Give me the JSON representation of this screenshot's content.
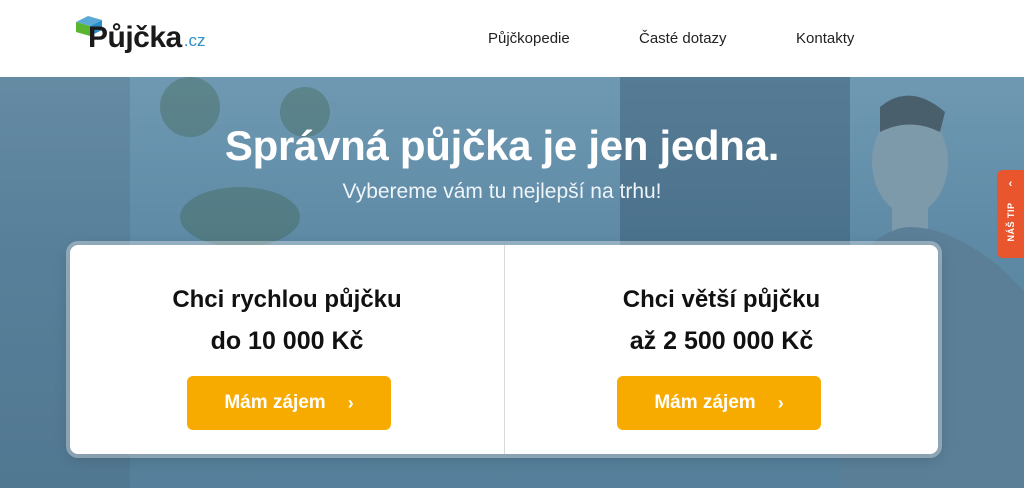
{
  "header": {
    "logo_text": "Půjčka",
    "logo_tld": ".cz",
    "nav": [
      {
        "label": "Půjčkopedie"
      },
      {
        "label": "Časté dotazy"
      },
      {
        "label": "Kontakty"
      }
    ]
  },
  "hero": {
    "title": "Správná půjčka je jen jedna.",
    "subtitle": "Vybereme vám tu nejlepší na trhu!"
  },
  "offers": [
    {
      "line1": "Chci rychlou půjčku",
      "line2": "do 10 000 Kč",
      "button": "Mám zájem",
      "arrow": "›"
    },
    {
      "line1": "Chci větší půjčku",
      "line2": "až 2 500 000 Kč",
      "button": "Mám zájem",
      "arrow": "›"
    }
  ],
  "side_tab": {
    "label": "NÁŠ TIP",
    "arrow": "‹"
  },
  "colors": {
    "accent": "#f7ab00",
    "tip": "#e9552d",
    "logo_blue": "#2a8fc9",
    "logo_green": "#5cb531"
  }
}
